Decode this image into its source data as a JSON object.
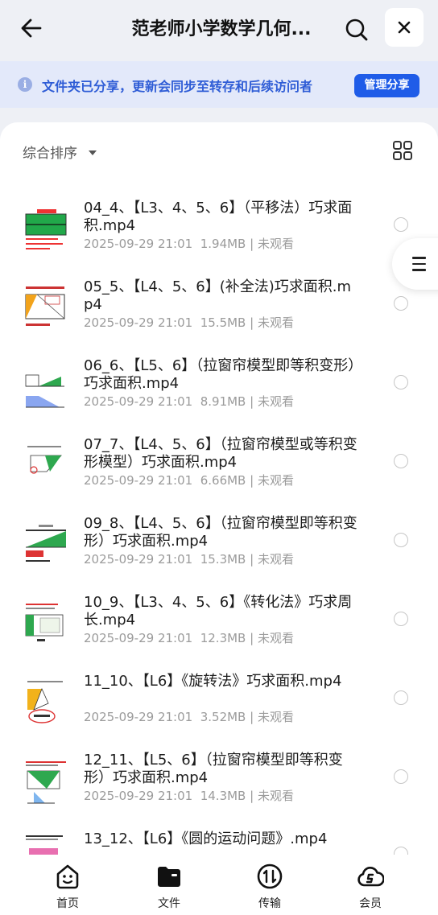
{
  "header": {
    "title": "范老师小学数学几何...",
    "back_icon": "arrow-left-icon",
    "search_icon": "search-icon",
    "close_icon": "close-icon"
  },
  "banner": {
    "text": "文件夹已分享，更新会同步至转存和后续访问者",
    "button": "管理分享"
  },
  "toolbar": {
    "sort_label": "综合排序"
  },
  "files": [
    {
      "name": "04_4、【L3、4、5、6】（平移法）巧求面积.mp4",
      "date": "2025-09-29 21:01",
      "size": "1.94MB",
      "status": "未观看"
    },
    {
      "name": "05_5、【L4、5、6】(补全法)巧求面积.mp4",
      "date": "2025-09-29 21:01",
      "size": "15.5MB",
      "status": "未观看"
    },
    {
      "name": "06_6、【L5、6】（拉窗帘模型即等积变形）巧求面积.mp4",
      "date": "2025-09-29 21:01",
      "size": "8.91MB",
      "status": "未观看"
    },
    {
      "name": "07_7、【L4、5、6】（拉窗帘模型或等积变形模型）巧求面积.mp4",
      "date": "2025-09-29 21:01",
      "size": "6.66MB",
      "status": "未观看"
    },
    {
      "name": "09_8、【L4、5、6】（拉窗帘模型即等积变形）巧求面积.mp4",
      "date": "2025-09-29 21:01",
      "size": "15.3MB",
      "status": "未观看"
    },
    {
      "name": "10_9、【L3、4、5、6】《转化法》巧求周长.mp4",
      "date": "2025-09-29 21:01",
      "size": "12.3MB",
      "status": "未观看"
    },
    {
      "name": "11_10、【L6】《旋转法》巧求面积.mp4",
      "date": "2025-09-29 21:01",
      "size": "3.52MB",
      "status": "未观看"
    },
    {
      "name": "12_11、【L5、6】（拉窗帘模型即等积变形）巧求面积.mp4",
      "date": "2025-09-29 21:01",
      "size": "14.3MB",
      "status": "未观看"
    },
    {
      "name": "13_12、【L6】《圆的运动问题》.mp4",
      "date": "",
      "size": "",
      "status": ""
    }
  ],
  "nav": [
    {
      "label": "首页",
      "icon": "home-smile-icon"
    },
    {
      "label": "文件",
      "icon": "folder-icon"
    },
    {
      "label": "传输",
      "icon": "transfer-icon"
    },
    {
      "label": "会员",
      "icon": "vip-cloud-icon"
    }
  ],
  "colors": {
    "accent": "#1f5ce8",
    "banner_bg": "#e3e9fa",
    "banner_text": "#2f5dd6"
  }
}
